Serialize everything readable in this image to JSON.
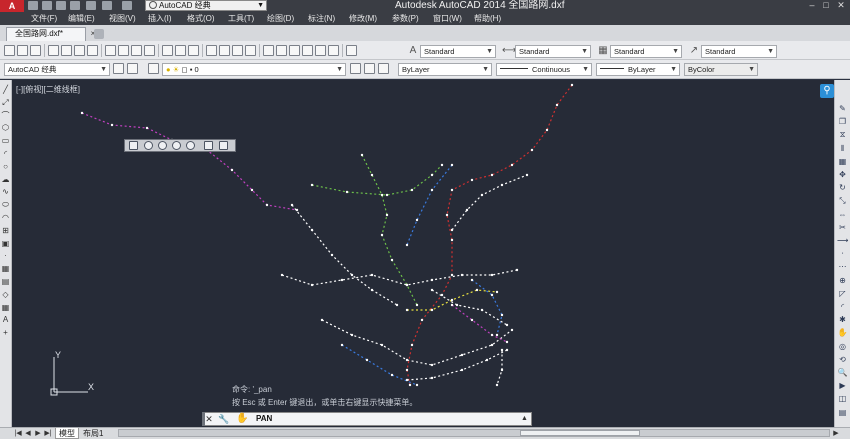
{
  "title_bar": {
    "app_logo": "A",
    "workspace": "AutoCAD 经典",
    "title": "Autodesk AutoCAD 2014    全国路网.dxf",
    "window_buttons": [
      "–",
      "□",
      "✕"
    ]
  },
  "menu": [
    "文件(F)",
    "编辑(E)",
    "视图(V)",
    "插入(I)",
    "格式(O)",
    "工具(T)",
    "绘图(D)",
    "标注(N)",
    "修改(M)",
    "参数(P)",
    "窗口(W)",
    "帮助(H)"
  ],
  "tabs": {
    "document": "全国路网.dxf*",
    "close": "×"
  },
  "styles_toolbar": {
    "text_style": "Standard",
    "dim_style": "Standard",
    "table_style": "Standard",
    "multileader_style": "Standard"
  },
  "layers_toolbar": {
    "workspace_combo": "AutoCAD 经典",
    "current_layer": "0",
    "color": "ByLayer",
    "linetype": "Continuous",
    "lineweight": "ByLayer",
    "plot_style": "ByColor"
  },
  "viewport": {
    "label": "[-][俯视][二维线框]",
    "ucs_y": "Y",
    "ucs_x": "X"
  },
  "command": {
    "history": [
      "命令: '_pan",
      "按 Esc 或 Enter 键退出，或单击右键显示快捷菜单。"
    ],
    "current": "PAN"
  },
  "layout_tabs": [
    "模型",
    "布局1"
  ],
  "colors": {
    "canvas": "#262b37",
    "title_bar": "#3a3d44",
    "accent": "#2c8fd6",
    "route_colors": [
      "#d03030",
      "#c040c0",
      "#6cbf4a",
      "#3a7be0",
      "#e8e040",
      "#ffffff"
    ]
  }
}
